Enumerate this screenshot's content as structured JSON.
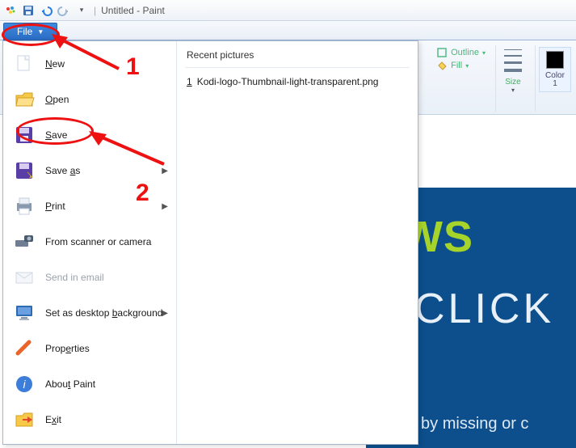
{
  "title": "Untitled - Paint",
  "file_tab": "File",
  "menu": {
    "new": "New",
    "open": "Open",
    "save": "Save",
    "save_as": "Save as",
    "print": "Print",
    "scanner": "From scanner or camera",
    "email": "Send in email",
    "desktop": "Set as desktop background",
    "properties": "Properties",
    "about": "About Paint",
    "exit": "Exit"
  },
  "recent": {
    "header": "Recent pictures",
    "items": [
      {
        "num": "1",
        "name": "Kodi-logo-Thumbnail-light-transparent.png"
      }
    ]
  },
  "ribbon": {
    "outline": "Outline",
    "fill": "Fill",
    "size": "Size",
    "color1": "Color\n1"
  },
  "canvas": {
    "ws": "WS",
    "click": "CLICK",
    "sub": "aused by missing or c"
  },
  "ann": {
    "one": "1",
    "two": "2"
  }
}
